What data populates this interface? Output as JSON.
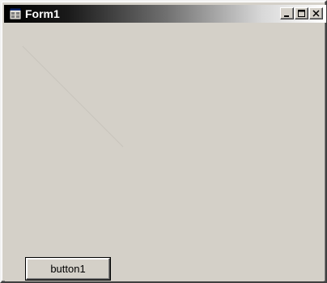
{
  "window": {
    "title": "Form1",
    "controls": {
      "minimize": "minimize-icon",
      "maximize": "maximize-icon",
      "close": "close-icon"
    }
  },
  "client": {
    "button_label": "button1"
  },
  "colors": {
    "window_face": "#d4d0c8",
    "title_start": "#000000",
    "title_end": "#ffffff",
    "title_text": "#ffffff",
    "diagonal_line": "#c8c4bc"
  }
}
